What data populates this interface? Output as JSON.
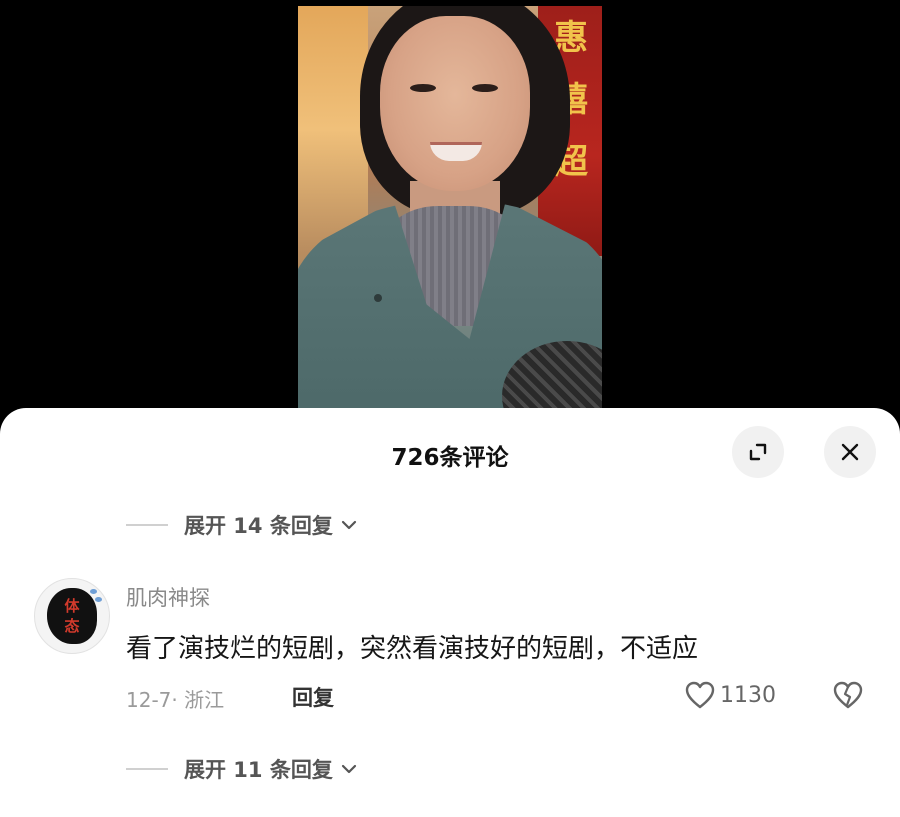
{
  "header": {
    "comment_count_title": "726条评论"
  },
  "video": {
    "banner_chars": [
      "惠",
      "禧",
      "超"
    ]
  },
  "replies_toggle_top": {
    "label": "展开 14 条回复"
  },
  "comment": {
    "username": "肌肉神探",
    "avatar_text": [
      "体",
      "态"
    ],
    "text": "看了演技烂的短剧，突然看演技好的短剧，不适应",
    "date_location": "12-7· 浙江",
    "reply_label": "回复",
    "like_count": "1130"
  },
  "replies_toggle_bottom": {
    "label": "展开 11 条回复"
  },
  "icons": {
    "expand": "expand-icon",
    "close": "close-icon",
    "chevron": "chevron-down-icon",
    "like": "heart-icon",
    "dislike": "broken-heart-icon"
  },
  "colors": {
    "sheet_background": "#ffffff",
    "button_background": "#f1f1f1",
    "text_primary": "#161616",
    "text_secondary": "#8a8a8a"
  }
}
